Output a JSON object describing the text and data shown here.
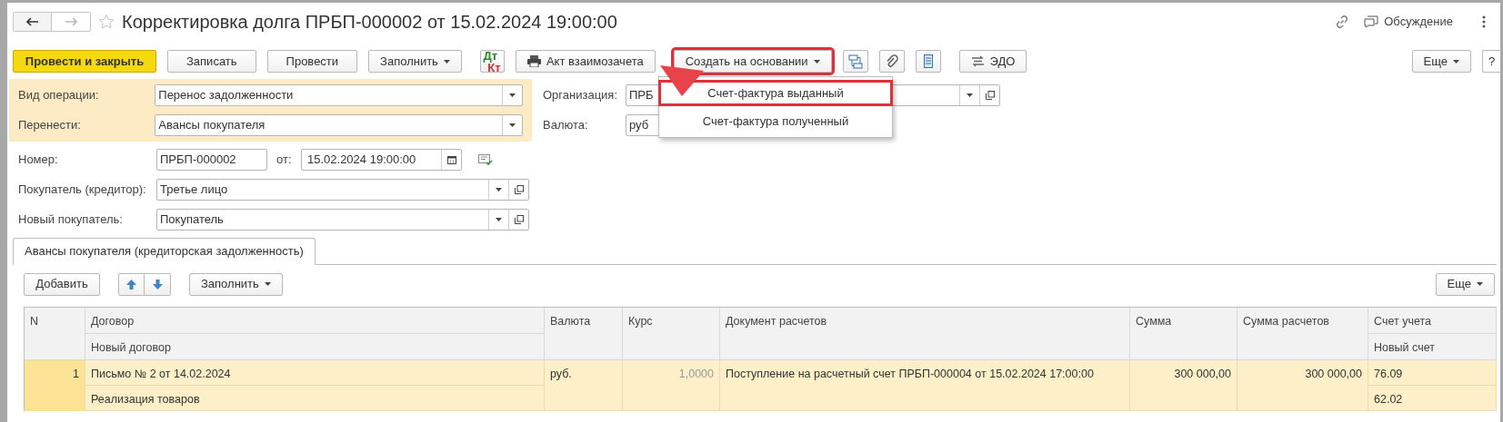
{
  "window": {
    "title": "Корректировка долга ПРБП-000002 от 15.02.2024 19:00:00",
    "discussion": "Обсуждение"
  },
  "toolbar": [
    {
      "kind": "primary",
      "label": "Провести и закрыть"
    },
    {
      "kind": "button",
      "label": "Записать"
    },
    {
      "kind": "button",
      "label": "Провести"
    },
    {
      "kind": "dropdown",
      "label": "Заполнить"
    },
    {
      "kind": "dtkt",
      "top": "Дт",
      "bottom": "Кт"
    },
    {
      "kind": "print",
      "label": "Акт взаимозачета"
    },
    {
      "kind": "dropdown",
      "label": "Создать на основании",
      "highlighted": true
    },
    {
      "kind": "structure"
    },
    {
      "kind": "attach"
    },
    {
      "kind": "list"
    },
    {
      "kind": "edo",
      "label": "ЭДО"
    }
  ],
  "more": "Еще",
  "help": "?",
  "menu": [
    {
      "label": "Счет-фактура выданный",
      "highlighted": true
    },
    {
      "label": "Счет-фактура полученный",
      "highlighted": false
    }
  ],
  "operation": {
    "label": "Вид операции:",
    "value": "Перенос задолженности"
  },
  "transfer": {
    "label": "Перенести:",
    "value": "Авансы покупателя"
  },
  "organization": {
    "label": "Организация:",
    "value": "ПРБ"
  },
  "currency": {
    "label": "Валюта:",
    "value": "руб"
  },
  "number": {
    "label": "Номер:",
    "value": "ПРБП-000002",
    "date_label": "от:",
    "date": "15.02.2024 19:00:00"
  },
  "buyer": {
    "label": "Покупатель (кредитор):",
    "value": "Третье лицо"
  },
  "new_buyer": {
    "label": "Новый покупатель:",
    "value": "Покупатель"
  },
  "tabs": [
    {
      "label": "Авансы покупателя (кредиторская задолженность)",
      "selected": true
    }
  ],
  "table_toolbar": {
    "add": "Добавить",
    "fill": "Заполнить",
    "more": "Еще"
  },
  "table": {
    "columns": [
      {
        "label": "N"
      },
      {
        "label": "Договор",
        "sublabel": "Новый договор"
      },
      {
        "label": "Валюта"
      },
      {
        "label": "Курс"
      },
      {
        "label": "Документ расчетов"
      },
      {
        "label": "Сумма"
      },
      {
        "label": "Сумма расчетов"
      },
      {
        "label": "Счет учета",
        "sublabel": "Новый счет"
      }
    ],
    "rows": [
      {
        "selected": true,
        "n": "1",
        "contract": "Письмо № 2 от 14.02.2024",
        "new_contract": "Реализация товаров",
        "currency": "руб.",
        "rate": "1,0000",
        "document": "Поступление на расчетный счет ПРБП-000004 от 15.02.2024 17:00:00",
        "sum": "300 000,00",
        "settlement_sum": "300 000,00",
        "account": "76.09",
        "new_account": "62.02"
      }
    ]
  }
}
